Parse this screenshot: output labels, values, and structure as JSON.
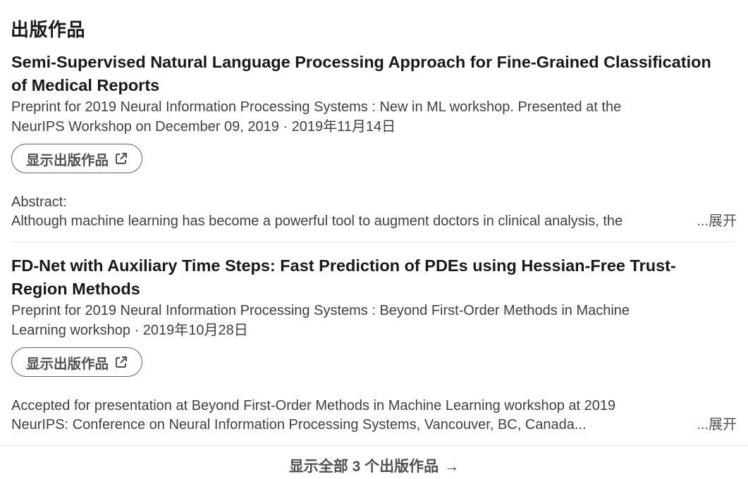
{
  "section": {
    "title": "出版作品"
  },
  "publications": [
    {
      "title_line1": "Semi-Supervised Natural Language Processing Approach for Fine-Grained Classification",
      "title_line2": "of Medical Reports",
      "meta_line1": "Preprint for 2019 Neural Information Processing Systems : New in ML workshop. Presented at the",
      "meta_line2": "NeurIPS Workshop on December 09, 2019 · 2019年11月14日",
      "button_label": "显示出版作品",
      "button_icon": "external-link-icon",
      "abstract_line1": "Abstract:",
      "abstract_line2": "Although machine learning has become a powerful tool to augment doctors in clinical analysis, the",
      "more_label": "...展开"
    },
    {
      "title_line1": "FD-Net with Auxiliary Time Steps: Fast Prediction of PDEs using Hessian-Free Trust-",
      "title_line2": "Region Methods",
      "meta_line1": "Preprint for 2019 Neural Information Processing Systems : Beyond First-Order Methods in Machine",
      "meta_line2": "Learning workshop · 2019年10月28日",
      "button_label": "显示出版作品",
      "button_icon": "external-link-icon",
      "abstract_line1": "Accepted for presentation at Beyond First-Order Methods in Machine Learning workshop at 2019",
      "abstract_line2": "NeurIPS: Conference on Neural Information Processing Systems, Vancouver, BC, Canada...",
      "more_label": "...展开"
    }
  ],
  "footer": {
    "show_all_label": "显示全部 3 个出版作品",
    "arrow": "→"
  }
}
